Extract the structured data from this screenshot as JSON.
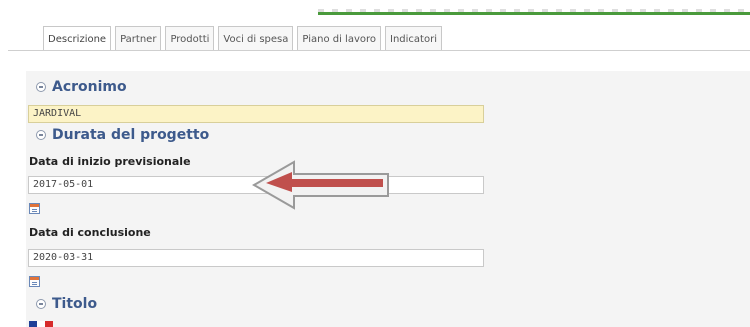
{
  "tabs": [
    {
      "label": "Descrizione",
      "active": true
    },
    {
      "label": "Partner"
    },
    {
      "label": "Prodotti"
    },
    {
      "label": "Voci di spesa"
    },
    {
      "label": "Piano di lavoro"
    },
    {
      "label": "Indicatori"
    }
  ],
  "sections": {
    "acronimo": "Acronimo",
    "durata": "Durata del progetto",
    "titolo": "Titolo"
  },
  "fields": {
    "acronimo_value": "JARDIVAL",
    "data_inizio_label": "Data di inizio previsionale",
    "data_inizio_value": "2017-05-01",
    "data_conclusione_label": "Data di conclusione",
    "data_conclusione_value": "2020-03-31"
  },
  "colors": {
    "section_title": "#3d5a8c",
    "arrow_fill": "#c0504d",
    "acronimo_bg": "#fcf3c6"
  },
  "icons": {
    "calendar": "calendar-icon",
    "expand": "expand-icon",
    "arrow": "left-arrow-annotation"
  }
}
